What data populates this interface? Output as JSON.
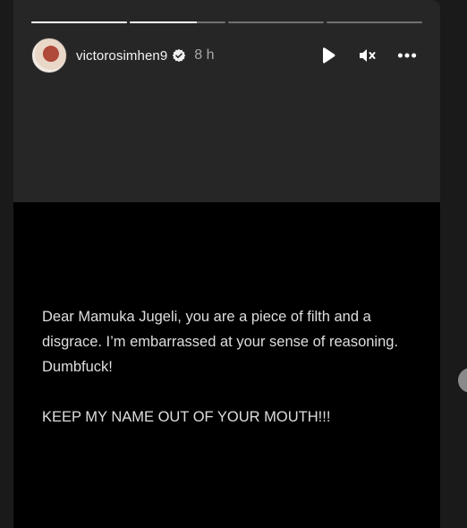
{
  "story": {
    "progress": [
      {
        "fill": 1.0
      },
      {
        "fill": 0.7
      },
      {
        "fill": 0.0
      },
      {
        "fill": 0.0
      }
    ],
    "user": {
      "username": "victorosimhen9",
      "verified_icon": "verified-badge-icon",
      "time": "8 h"
    },
    "controls": {
      "play_icon": "play-icon",
      "mute_icon": "muted-speaker-icon",
      "more_icon": "more-options-icon"
    },
    "message": {
      "line1": "Dear Mamuka Jugeli, you are a piece of filth and a disgrace. I’m embarrassed at your sense of reasoning. Dumbfuck!",
      "line2": "KEEP MY NAME OUT OF YOUR MOUTH!!!"
    }
  },
  "colors": {
    "background": "#1a1a1a",
    "story_panel": "#262626",
    "media": "#000000",
    "text": "#dedede"
  }
}
